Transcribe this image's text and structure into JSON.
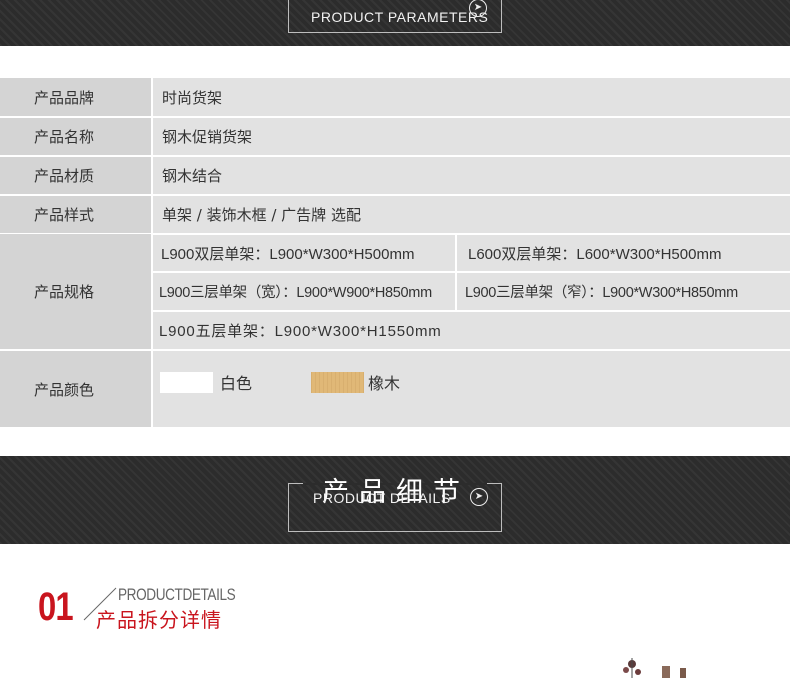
{
  "header": {
    "subtitle": "PRODUCT PARAMETERS"
  },
  "params": {
    "brand": {
      "label": "产品品牌",
      "value": "时尚货架"
    },
    "name": {
      "label": "产品名称",
      "value": "钢木促销货架"
    },
    "material": {
      "label": "产品材质",
      "value": "钢木结合"
    },
    "style": {
      "label": "产品样式",
      "value": "单架 / 装饰木框 / 广告牌  选配"
    },
    "spec": {
      "label": "产品规格",
      "items": [
        "L900双层单架：L900*W300*H500mm",
        "L600双层单架：L600*W300*H500mm",
        "L900三层单架（宽）：L900*W900*H850mm",
        "L900三层单架（窄）：L900*W300*H850mm",
        "L900五层单架：L900*W300*H1550mm"
      ]
    },
    "color": {
      "label": "产品颜色",
      "options": [
        {
          "name": "白色",
          "swatch": "#ffffff"
        },
        {
          "name": "橡木",
          "swatch": "#e0b877"
        }
      ]
    }
  },
  "details": {
    "title_cn": "产品细节",
    "subtitle_en": "PRODUCT DETAILS",
    "section_number": "01",
    "section_en": "PRODUCTDETAILS",
    "section_cn": "产品拆分详情"
  },
  "colors": {
    "accent_red": "#c9151e",
    "banner_dark": "#2c2c2c",
    "label_bg": "#d4d4d4",
    "value_bg": "#e2e2e2"
  },
  "icons": [
    "arrow-right-circle-icon",
    "slash-line-icon"
  ]
}
